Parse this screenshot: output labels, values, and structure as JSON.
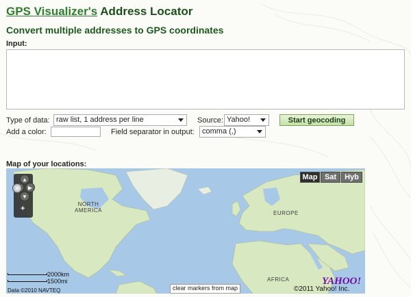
{
  "header": {
    "title_link": "GPS Visualizer's",
    "title_rest": " Address Locator",
    "subtitle": "Convert multiple addresses to GPS coordinates"
  },
  "form": {
    "input_label": "Input:",
    "input_value": "",
    "type_label": "Type of data:",
    "type_value": "raw list, 1 address per line",
    "source_label": "Source:",
    "source_value": "Yahoo!",
    "start_button": "Start geocoding",
    "color_label": "Add a color:",
    "color_value": "",
    "separator_label": "Field separator in output:",
    "separator_value": "comma (,)"
  },
  "map": {
    "section_label": "Map of your locations:",
    "types": [
      "Map",
      "Sat",
      "Hyb"
    ],
    "active_type": "Map",
    "regions": {
      "north_america": "NORTH\nAMERICA",
      "europe": "EUROPE",
      "africa": "AFRICA"
    },
    "scale_km": "2000km",
    "scale_mi": "1500mi",
    "data_credit": "Data ©2010 NAVTEQ",
    "clear_markers": "clear markers from map",
    "copyright": "©2011 Yahoo! Inc.",
    "logo_text": "YAHOO!"
  },
  "colors": {
    "title_green": "#1c5a1c",
    "link_green": "#2e7d2e",
    "ocean": "#a8c8e8",
    "land": "#d8e8c0",
    "button_green": "#c6e0a6"
  }
}
